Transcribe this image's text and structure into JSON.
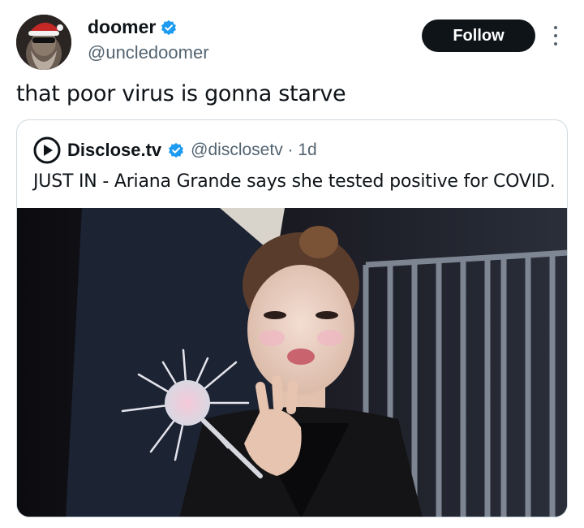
{
  "author": {
    "name": "doomer",
    "handle": "@uncledoomer",
    "verified_color": "#1d9bf0"
  },
  "follow_label": "Follow",
  "tweet": {
    "text": "that poor virus is gonna starve"
  },
  "quoted": {
    "name": "Disclose.tv",
    "handle_time": "@disclosetv · 1d",
    "text": "JUST IN - Ariana Grande says she tested positive for COVID."
  },
  "colors": {
    "text_primary": "#0f1419",
    "text_secondary": "#536471",
    "border": "#cfd9de",
    "follow_bg": "#0f1419",
    "verified": "#1d9bf0"
  },
  "icons": {
    "more": "more-vertical-icon",
    "verified": "verified-badge-icon",
    "quote_logo": "disclose-play-logo-icon"
  }
}
